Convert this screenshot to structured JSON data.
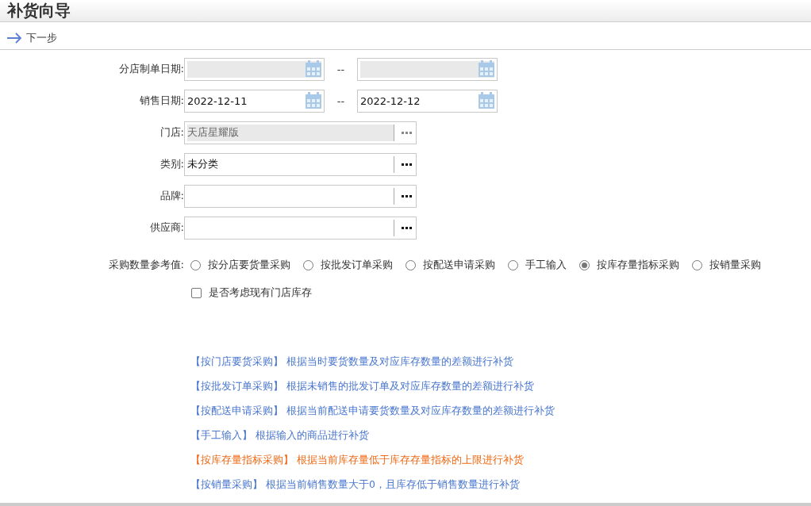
{
  "window": {
    "title": "补货向导"
  },
  "toolbar": {
    "next_button": "下一步"
  },
  "date_rows": [
    {
      "label": "分店制单日期:",
      "from": {
        "disabled": true
      },
      "separator": "--",
      "to": {
        "disabled": true
      }
    },
    {
      "label": "销售日期:",
      "from": {
        "value": "2022-12-11",
        "disabled": false
      },
      "separator": "--",
      "to": {
        "value": "2022-12-12",
        "disabled": false
      }
    }
  ],
  "lookup_rows": [
    {
      "label": "门店:",
      "value": "天店星耀版",
      "disabled": true
    },
    {
      "label": "类别:",
      "value": "未分类",
      "disabled": false
    },
    {
      "label": "品牌:",
      "disabled": false
    },
    {
      "label": "供应商:",
      "disabled": false
    }
  ],
  "purchase_reference": {
    "label": "采购数量参考值:",
    "options": [
      {
        "label": "按分店要货量采购",
        "selected": false
      },
      {
        "label": "按批发订单采购",
        "selected": false
      },
      {
        "label": "按配送申请采购",
        "selected": false
      },
      {
        "label": "手工输入",
        "selected": false
      },
      {
        "label": "按库存量指标采购",
        "selected": true
      },
      {
        "label": "按销量采购",
        "selected": false
      }
    ]
  },
  "consider_stock": {
    "label": "是否考虑现有门店库存",
    "checked": false
  },
  "hints": [
    {
      "title": "【按门店要货采购】",
      "text": "根据当时要货数量及对应库存数量的差额进行补货",
      "highlighted": false
    },
    {
      "title": "【按批发订单采购】",
      "text": "根据未销售的批发订单及对应库存数量的差额进行补货",
      "highlighted": false
    },
    {
      "title": "【按配送申请采购】",
      "text": "根据当前配送申请要货数量及对应库存数量的差额进行补货",
      "highlighted": false
    },
    {
      "title": "【手工输入】",
      "text": "根据输入的商品进行补货",
      "highlighted": false
    },
    {
      "title": "【按库存量指标采购】",
      "text": "根据当前库存量低于库存存量指标的上限进行补货",
      "highlighted": true
    },
    {
      "title": "【按销量采购】",
      "text": "根据当前销售数量大于0，且库存低于销售数量进行补货",
      "highlighted": false
    }
  ]
}
